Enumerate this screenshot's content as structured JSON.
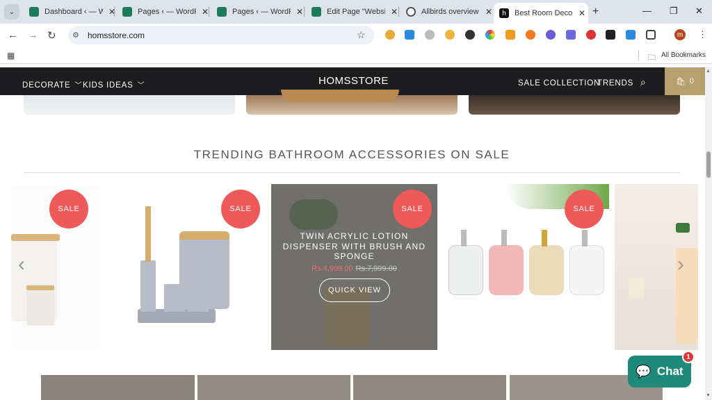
{
  "browser": {
    "tabs": [
      {
        "title": "Dashboard ‹ — Wi",
        "favicon_color": "#1e7b5a",
        "active": false
      },
      {
        "title": "Pages ‹ — WordPr",
        "favicon_color": "#1e7b5a",
        "active": false
      },
      {
        "title": "Pages ‹ — WordPr",
        "favicon_color": "#1e7b5a",
        "active": false
      },
      {
        "title": "Edit Page \"Website",
        "favicon_color": "#1e7b5a",
        "active": false
      },
      {
        "title": "Allbirds overview A",
        "favicon_color": "#555555",
        "active": false
      },
      {
        "title": "Best Room Decor A",
        "favicon_color": "#111111",
        "active": true
      }
    ],
    "new_tab": "+",
    "url": "homsstore.com",
    "all_bookmarks": "All Bookmarks",
    "profile_initial": "m"
  },
  "site": {
    "nav_left": [
      {
        "label": "DECORATE"
      },
      {
        "label": "KIDS IDEAS"
      }
    ],
    "logo": "HOMSSTORE",
    "nav_right": [
      {
        "label": "SALE COLLECTION"
      },
      {
        "label": "TRENDS"
      }
    ],
    "cart_count": "0",
    "section_title": "TRENDING BATHROOM ACCESSORIES ON SALE",
    "products": [
      {
        "badge": "SALE"
      },
      {
        "badge": "SALE"
      },
      {
        "badge": "SALE",
        "title": "TWIN ACRYLIC LOTION DISPENSER WITH BRUSH AND SPONGE",
        "price": "Rs.4,999.00",
        "compare_price": "Rs.7,999.00",
        "quick_view": "QUICK VIEW"
      },
      {
        "badge": "SALE"
      },
      {
        "badge": ""
      }
    ],
    "chat_label": "Chat",
    "chat_notifications": "1"
  },
  "colors": {
    "header_bg": "#1d1d1f",
    "cart_bg": "#b89f6f",
    "sale_badge": "#ee5a5a",
    "chat_bg": "#1f8a7a"
  }
}
